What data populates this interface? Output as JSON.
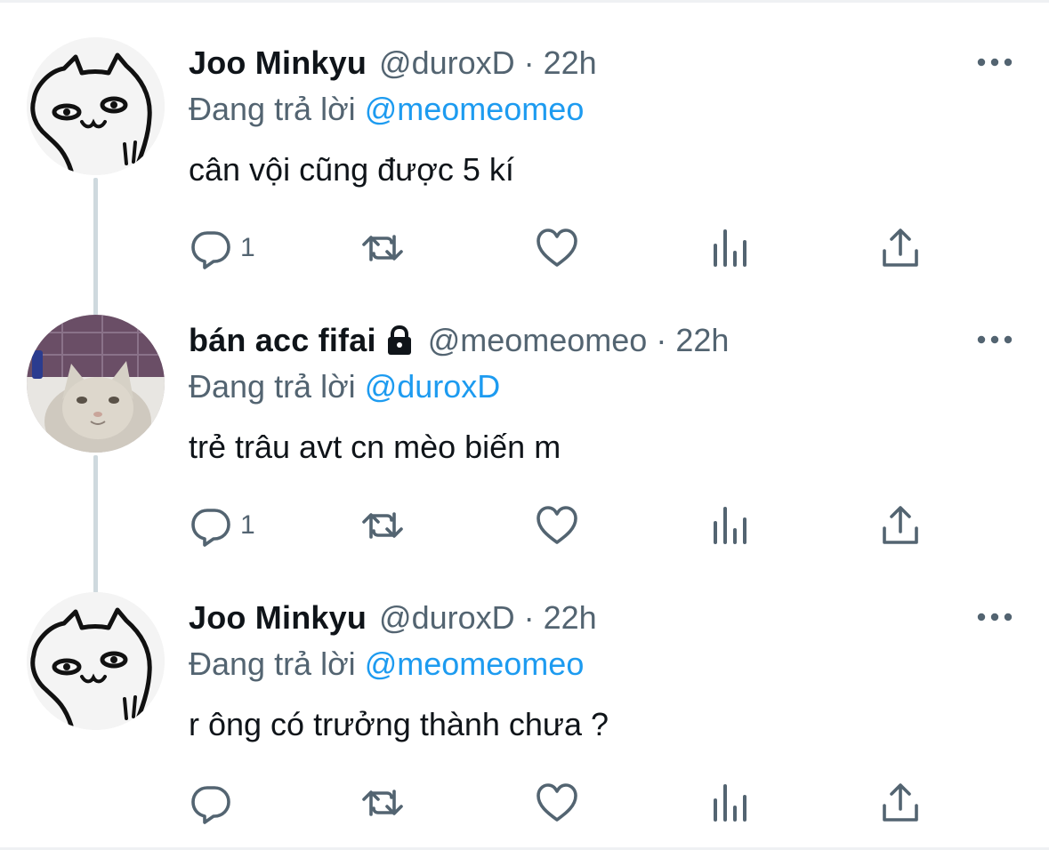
{
  "colors": {
    "primary_text": "#0f1419",
    "secondary_text": "#536471",
    "mention": "#1d9bf0",
    "icon": "#536471",
    "thread_line": "#cfd9de"
  },
  "tweets": [
    {
      "display_name": "Joo Minkyu",
      "handle": "@duroxD",
      "dot": "·",
      "time": "22h",
      "reply_prefix": "Đang trả lời",
      "reply_to": "@meomeomeo",
      "text": "cân vội cũng được 5 kí",
      "reply_count": "1",
      "avatar": "cat-doodle-avatar",
      "locked": false
    },
    {
      "display_name": "bán acc fifai",
      "handle": "@meomeomeo",
      "dot": "·",
      "time": "22h",
      "reply_prefix": "Đang trả lời",
      "reply_to": "@duroxD",
      "text": "trẻ trâu avt cn mèo biến m",
      "reply_count": "1",
      "avatar": "cat-photo-avatar",
      "locked": true
    },
    {
      "display_name": "Joo Minkyu",
      "handle": "@duroxD",
      "dot": "·",
      "time": "22h",
      "reply_prefix": "Đang trả lời",
      "reply_to": "@meomeomeo",
      "text": "r ông có trưởng thành chưa ?",
      "reply_count": "",
      "avatar": "cat-doodle-avatar",
      "locked": false
    }
  ],
  "icons": {
    "reply": "reply-icon",
    "retweet": "retweet-icon",
    "like": "heart-icon",
    "analytics": "analytics-icon",
    "share": "share-icon",
    "more": "more-icon",
    "lock": "lock-icon"
  }
}
